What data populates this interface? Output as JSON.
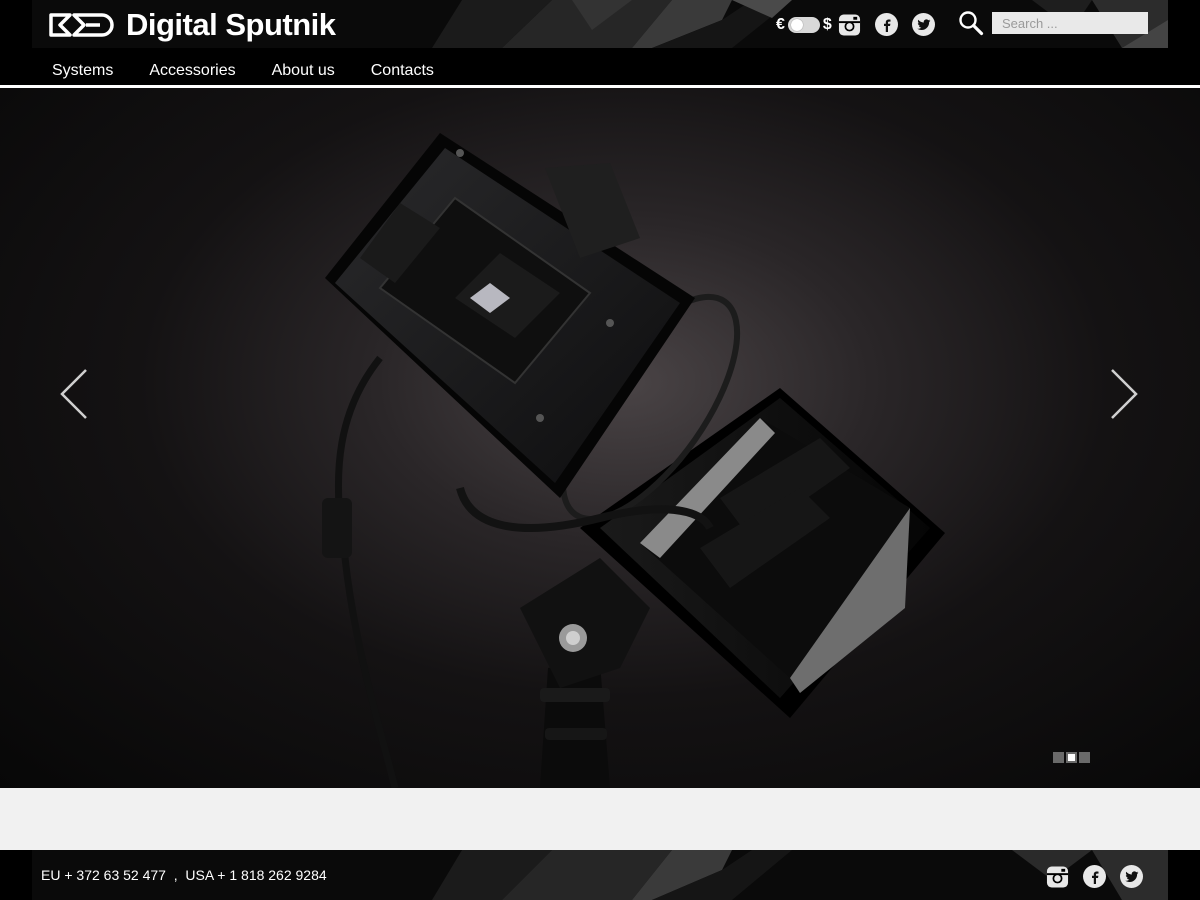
{
  "brand": {
    "name": "Digital Sputnik",
    "accent_color": "#ffffff",
    "logo_icon": "ds-logo-icon"
  },
  "header": {
    "currency": {
      "left": "€",
      "right": "$",
      "selected": "€"
    },
    "social": [
      {
        "name": "instagram",
        "icon": "instagram-icon"
      },
      {
        "name": "facebook",
        "icon": "facebook-icon"
      },
      {
        "name": "twitter",
        "icon": "twitter-icon"
      }
    ],
    "search": {
      "placeholder": "Search ...",
      "value": ""
    }
  },
  "nav": {
    "items": [
      {
        "label": "Systems"
      },
      {
        "label": "Accessories"
      },
      {
        "label": "About us"
      },
      {
        "label": "Contacts"
      }
    ]
  },
  "slider": {
    "prev_icon": "chevron-left-icon",
    "next_icon": "chevron-right-icon",
    "slide_count": 3,
    "active_slide": 2
  },
  "footer": {
    "contacts": "EU + 372 63 52 477  ,  USA + 1 818 262 9284"
  }
}
